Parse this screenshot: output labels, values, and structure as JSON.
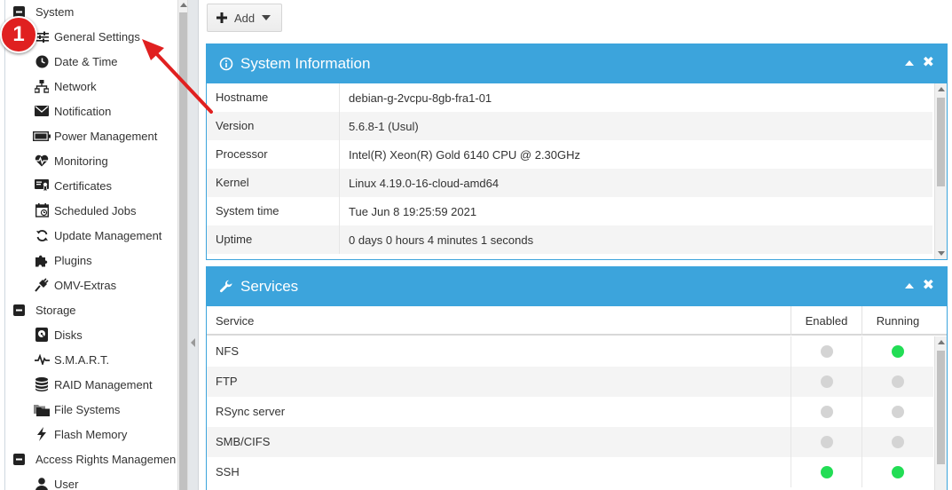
{
  "sidebar": {
    "items": [
      {
        "label": "System",
        "icon": "minus-square-icon",
        "type": "group"
      },
      {
        "label": "General Settings",
        "icon": "sliders-icon",
        "type": "child"
      },
      {
        "label": "Date & Time",
        "icon": "clock-icon",
        "type": "child"
      },
      {
        "label": "Network",
        "icon": "network-icon",
        "type": "child"
      },
      {
        "label": "Notification",
        "icon": "envelope-icon",
        "type": "child"
      },
      {
        "label": "Power Management",
        "icon": "battery-icon",
        "type": "child"
      },
      {
        "label": "Monitoring",
        "icon": "heartbeat-icon",
        "type": "child"
      },
      {
        "label": "Certificates",
        "icon": "certificate-icon",
        "type": "child"
      },
      {
        "label": "Scheduled Jobs",
        "icon": "calendar-icon",
        "type": "child"
      },
      {
        "label": "Update Management",
        "icon": "refresh-icon",
        "type": "child"
      },
      {
        "label": "Plugins",
        "icon": "puzzle-icon",
        "type": "child"
      },
      {
        "label": "OMV-Extras",
        "icon": "plug-icon",
        "type": "child"
      },
      {
        "label": "Storage",
        "icon": "minus-square-icon",
        "type": "group"
      },
      {
        "label": "Disks",
        "icon": "hdd-icon",
        "type": "child"
      },
      {
        "label": "S.M.A.R.T.",
        "icon": "pulse-icon",
        "type": "child"
      },
      {
        "label": "RAID Management",
        "icon": "database-icon",
        "type": "child"
      },
      {
        "label": "File Systems",
        "icon": "folders-icon",
        "type": "child"
      },
      {
        "label": "Flash Memory",
        "icon": "flash-icon",
        "type": "child"
      },
      {
        "label": "Access Rights Managemen",
        "icon": "minus-square-icon",
        "type": "group"
      },
      {
        "label": "User",
        "icon": "user-icon",
        "type": "child"
      }
    ]
  },
  "toolbar": {
    "add_label": "Add"
  },
  "sysinfo": {
    "title": "System Information",
    "rows": [
      {
        "key": "Hostname",
        "value": "debian-g-2vcpu-8gb-fra1-01"
      },
      {
        "key": "Version",
        "value": "5.6.8-1 (Usul)"
      },
      {
        "key": "Processor",
        "value": "Intel(R) Xeon(R) Gold 6140 CPU @ 2.30GHz"
      },
      {
        "key": "Kernel",
        "value": "Linux 4.19.0-16-cloud-amd64"
      },
      {
        "key": "System time",
        "value": "Tue Jun 8 19:25:59 2021"
      },
      {
        "key": "Uptime",
        "value": "0 days 0 hours 4 minutes 1 seconds"
      }
    ]
  },
  "services": {
    "title": "Services",
    "columns": [
      "Service",
      "Enabled",
      "Running"
    ],
    "rows": [
      {
        "name": "NFS",
        "enabled": false,
        "running": true
      },
      {
        "name": "FTP",
        "enabled": false,
        "running": false
      },
      {
        "name": "RSync server",
        "enabled": false,
        "running": false
      },
      {
        "name": "SMB/CIFS",
        "enabled": false,
        "running": false
      },
      {
        "name": "SSH",
        "enabled": true,
        "running": true
      }
    ]
  },
  "annotation": {
    "step": "1"
  },
  "colors": {
    "accent": "#3ca4dc",
    "status_on": "#22dd55",
    "status_off": "#d4d4d4",
    "annotation": "#e02020"
  }
}
